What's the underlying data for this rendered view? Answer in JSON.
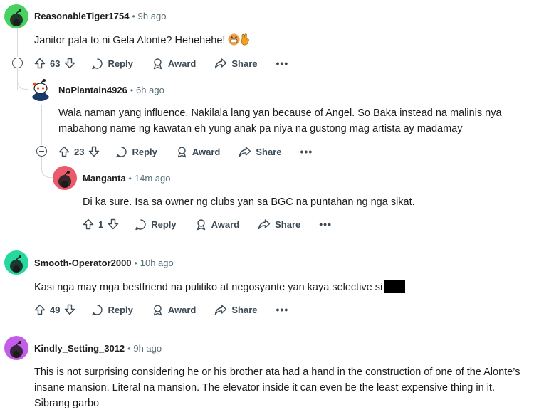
{
  "comments": [
    {
      "username": "ReasonableTiger1754",
      "time": "9h ago",
      "text": "Janitor pala to ni Gela Alonte? Hehehehe!",
      "votes": "63",
      "avatar_color": "#46d160"
    },
    {
      "username": "NoPlantain4926",
      "time": "6h ago",
      "text": "Wala naman yang influence. Nakilala lang yan because of Angel. So Baka instead na malinis nya mabahong name ng kawatan eh yung anak pa niya na gustong mag artista ay madamay",
      "votes": "23",
      "avatar_color": "#ffffff"
    },
    {
      "username": "Manganta",
      "time": "14m ago",
      "text": "Di ka sure. Isa sa owner ng clubs yan sa BGC na puntahan ng nga sikat.",
      "votes": "1",
      "avatar_color": "#ea5a6a"
    },
    {
      "username": "Smooth-Operator2000",
      "time": "10h ago",
      "text": "Kasi nga may mga bestfriend na pulitiko at negosyante yan kaya selective si",
      "votes": "49",
      "avatar_color": "#24d8a0"
    },
    {
      "username": "Kindly_Setting_3012",
      "time": "9h ago",
      "text": "This is not surprising considering he or his brother ata had a hand in the construction of one of the Alonte’s insane mansion. Literal na mansion. The elevator inside it can even be the least expensive thing in it. Sibrang garbo",
      "avatar_color": "#c35ce8"
    }
  ],
  "actions": {
    "reply": "Reply",
    "award": "Award",
    "share": "Share",
    "more": "•••",
    "dot": "•"
  },
  "icons": [
    "upvote-icon",
    "downvote-icon",
    "reply-icon",
    "award-icon",
    "share-icon",
    "collapse-icon",
    "grinning-emoji-icon",
    "hand-emoji-icon"
  ],
  "colors": {
    "text": "#1c1c1c",
    "muted": "#576f76",
    "action": "#3b4a54",
    "line": "#d7dadc"
  }
}
